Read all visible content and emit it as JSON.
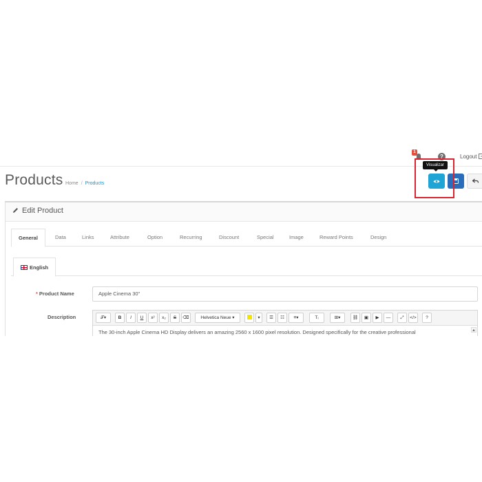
{
  "header": {
    "notification_count": "1",
    "help_label": "?",
    "logout_label": "Logout"
  },
  "page": {
    "title": "Products",
    "breadcrumb": [
      "Home",
      "Products"
    ]
  },
  "actions": {
    "tooltip": "Visualizar"
  },
  "panel": {
    "title": "Edit Product"
  },
  "tabs": [
    "General",
    "Data",
    "Links",
    "Attribute",
    "Option",
    "Recurring",
    "Discount",
    "Special",
    "Image",
    "Reward Points",
    "Design"
  ],
  "language_tab": "English",
  "form": {
    "product_name": {
      "label": "Product Name",
      "value": "Apple Cinema 30\""
    },
    "description": {
      "label": "Description",
      "text": "The 30-inch Apple Cinema HD Display delivers an amazing 2560 x 1600 pixel resolution. Designed specifically for the creative professional"
    }
  },
  "toolbar": {
    "font_family": "Helvetica Neue",
    "buttons": [
      "B",
      "I",
      "U",
      "x²",
      "x₂",
      "S",
      "Tᵢ",
      "⛓",
      "▣",
      "▶",
      "—",
      "⤢",
      "</>",
      "?"
    ]
  },
  "colors": {
    "view_button": "#1fa4d6",
    "save_button": "#2a6ebb",
    "highlight": "#d9232e",
    "link": "#1e91cf"
  }
}
